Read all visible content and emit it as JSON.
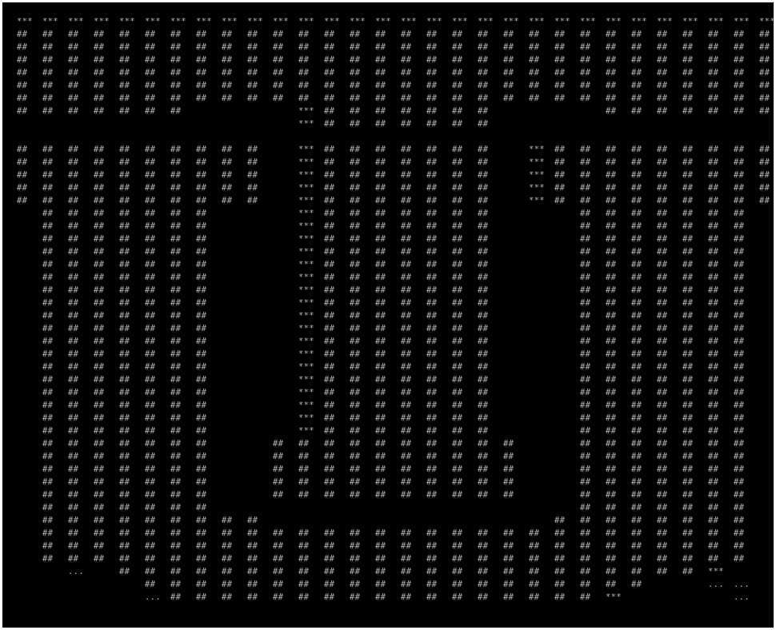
{
  "terminal": {
    "background_color": "#000000",
    "foreground_color": "#b4b4b4",
    "glyphs": {
      "H": "##",
      "S": "***",
      "D": "...",
      "B": "  "
    },
    "rows": [
      "SSSSSSSSSSSSSSSSSSSSSSSSSSSSSS",
      "HHHHHHHHHHHHHHHHHHHHHHHHHHHHHH",
      "HHHHHHHHHHHHHHHHHHHHHHHHHHHHHH",
      "HHHHHHHHHHHHHHHHHHHHHHHHHHHHHH",
      "HHHHHHHHHHHHHHHHHHHHHHHHHHHHHH",
      "HHHHHHHHHHHHHHHHHHHHHHHHHHHHHH",
      "HHHHHHHHHHHHHHHHHHHHHHHHHHHHHH",
      "HHHHHHHBBBBSHHHHHHHBBBBHHHHHHH",
      "BBBBBBBBBBBSHHHHHHHBBBBBBBBBBB",
      "BBBBBBBBBBBBBBBBBBBBBBBBBBBBBB",
      "HHHHHHHHHHBSHHHHHHHBSHHHHHHHHH",
      "HHHHHHHHHHBSHHHHHHHBSHHHHHHHHH",
      "HHHHHHHHHHBSHHHHHHHBSHHHHHHHHH",
      "HHHHHHHHHHBSHHHHHHHBSHHHHHHHHH",
      "HHHHHHHHHHBSHHHHHHHBSHHHHHHHHH",
      "BHHHHHHHBBBSHHHHHHHBBBHHHHHHHB",
      "BHHHHHHHBBBSHHHHHHHBBBHHHHHHHB",
      "BHHHHHHHBBBSHHHHHHHBBBHHHHHHHB",
      "BHHHHHHHBBBSHHHHHHHBBBHHHHHHHB",
      "BHHHHHHHBBBSHHHHHHHBBBHHHHHHHB",
      "BHHHHHHHBBBSHHHHHHHBBBHHHHHHHB",
      "BHHHHHHHBBBSHHHHHHHBBBHHHHHHHB",
      "BHHHHHHHBBBSHHHHHHHBBBHHHHHHHB",
      "BHHHHHHHBBBSHHHHHHHBBBHHHHHHHB",
      "BHHHHHHHBBBSHHHHHHHBBBHHHHHHHB",
      "BHHHHHHHBBBSHHHHHHHBBBHHHHHHHB",
      "BHHHHHHHBBBSHHHHHHHBBBHHHHHHHB",
      "BHHHHHHHBBBSHHHHHHHBBBHHHHHHHB",
      "BHHHHHHHBBBSHHHHHHHBBBHHHHHHHB",
      "BHHHHHHHBBBSHHHHHHHBBBHHHHHHHB",
      "BHHHHHHHBBBSHHHHHHHBBBHHHHHHHB",
      "BHHHHHHHBBBSHHHHHHHBBBHHHHHHHB",
      "BHHHHHHHBBBSHHHHHHHBBBHHHHHHHB",
      "BHHHHHHHBBHHHHHHHHHHBBHHHHHHHB",
      "BHHHHHHHBBHHHHHHHHHHBBHHHHHHHB",
      "BHHHHHHHBBHHHHHHHHHHBBHHHHHHHB",
      "BHHHHHHHBBHHHHHHHHHHBBHHHHHHHB",
      "BHHHHHHHBBHHHHHHHHHHBBHHHHHHHB",
      "BHHHHHHHBBBBBBBBBBBBBBHHHHHHHB",
      "BHHHHHHHHHBBBBBBBBBBBHHHHHHHHB",
      "BHHHHHHHHHHHHHHHHHHHHHHHHHHHHB",
      "BHHHHHHHHHHHHHHHHHHHHHHHHHHHHB",
      "BHHHHHHHHHHHHHHHHHHHHHHHHHHHHB",
      "BBDBHHHHHHHHHHHHHHHHHHHHHHHSBB",
      "BBBBBHHHHHHHHHHHHHHHHHHHHBBDDB",
      "BBBBBDHHHHHHHHHHHHHHHHHSBBBBDB"
    ]
  }
}
